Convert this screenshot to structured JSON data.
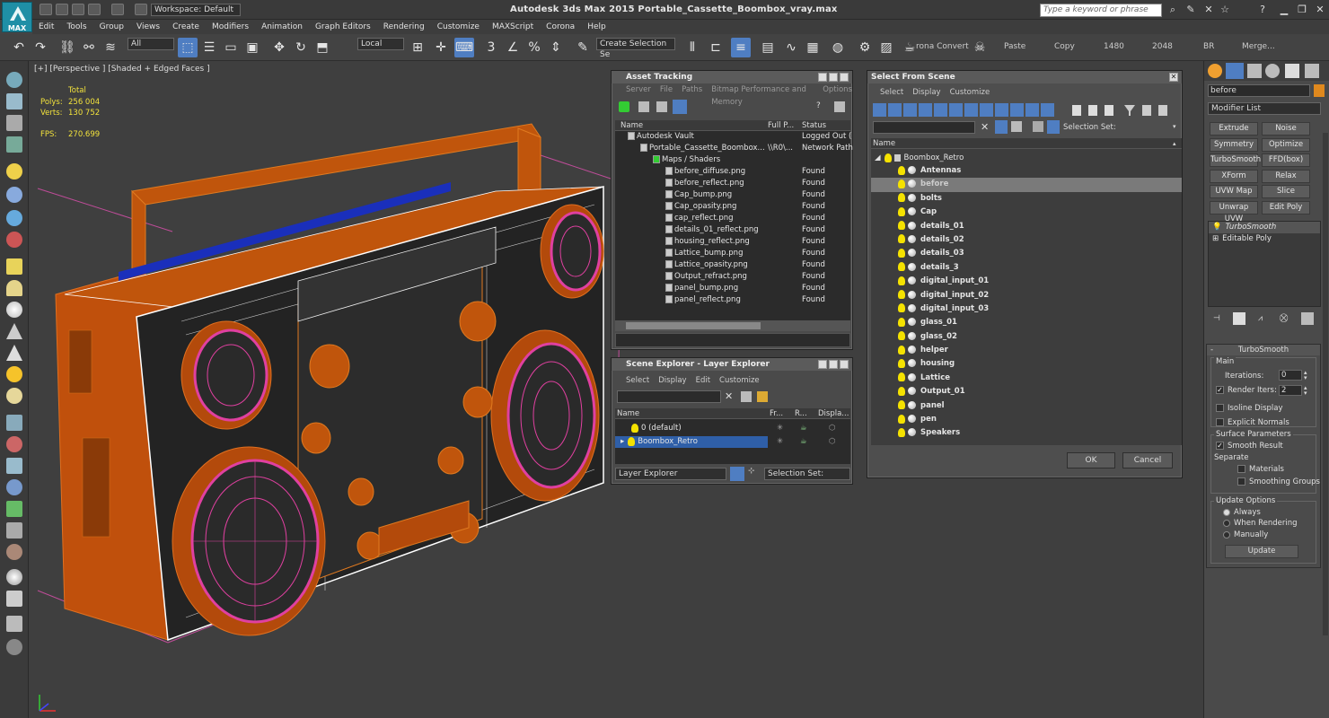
{
  "titlebar": {
    "logo_text": "MAX",
    "workspace": "Workspace: Default",
    "title": "Autodesk 3ds Max  2015     Portable_Cassette_Boombox_vray.max",
    "search_placeholder": "Type a keyword or phrase"
  },
  "menu": [
    "Edit",
    "Tools",
    "Group",
    "Views",
    "Create",
    "Modifiers",
    "Animation",
    "Graph Editors",
    "Rendering",
    "Customize",
    "MAXScript",
    "Corona",
    "Help"
  ],
  "toolbar": {
    "filter": "All",
    "coord": "Local",
    "selection_set": "Create Selection Se",
    "labels": [
      "rona Convert",
      "Paste",
      "Copy",
      "1480",
      "2048",
      "BR",
      "Merge..."
    ]
  },
  "viewport": {
    "label": "[+] [Perspective ] [Shaded + Edged Faces ]",
    "stats": {
      "total": "Total",
      "polys_label": "Polys:",
      "polys": "256 004",
      "verts_label": "Verts:",
      "verts": "130 752",
      "fps_label": "FPS:",
      "fps": "270.699"
    }
  },
  "asset_tracking": {
    "title": "Asset Tracking",
    "menu": [
      "Server",
      "File",
      "Paths",
      "Bitmap Performance and Memory",
      "Options"
    ],
    "columns": [
      "Name",
      "Full P...",
      "Status"
    ],
    "rows": [
      {
        "name": "Autodesk Vault",
        "path": "",
        "status": "Logged Out (",
        "indent": 0
      },
      {
        "name": "Portable_Cassette_Boombox...",
        "path": "\\\\R0\\...",
        "status": "Network Path",
        "indent": 1
      },
      {
        "name": "Maps / Shaders",
        "path": "",
        "status": "",
        "indent": 2
      },
      {
        "name": "before_diffuse.png",
        "path": "",
        "status": "Found",
        "indent": 3
      },
      {
        "name": "before_reflect.png",
        "path": "",
        "status": "Found",
        "indent": 3
      },
      {
        "name": "Cap_bump.png",
        "path": "",
        "status": "Found",
        "indent": 3
      },
      {
        "name": "Cap_opasity.png",
        "path": "",
        "status": "Found",
        "indent": 3
      },
      {
        "name": "cap_reflect.png",
        "path": "",
        "status": "Found",
        "indent": 3
      },
      {
        "name": "details_01_reflect.png",
        "path": "",
        "status": "Found",
        "indent": 3
      },
      {
        "name": "housing_reflect.png",
        "path": "",
        "status": "Found",
        "indent": 3
      },
      {
        "name": "Lattice_bump.png",
        "path": "",
        "status": "Found",
        "indent": 3
      },
      {
        "name": "Lattice_opasity.png",
        "path": "",
        "status": "Found",
        "indent": 3
      },
      {
        "name": "Output_refract.png",
        "path": "",
        "status": "Found",
        "indent": 3
      },
      {
        "name": "panel_bump.png",
        "path": "",
        "status": "Found",
        "indent": 3
      },
      {
        "name": "panel_reflect.png",
        "path": "",
        "status": "Found",
        "indent": 3
      }
    ]
  },
  "layer_explorer": {
    "title": "Scene Explorer - Layer Explorer",
    "menu": [
      "Select",
      "Display",
      "Edit",
      "Customize"
    ],
    "columns": [
      "Name",
      "Fr...",
      "R...",
      "Displa..."
    ],
    "rows": [
      "0 (default)",
      "Boombox_Retro"
    ],
    "footer_dropdown": "Layer Explorer",
    "selection_set": "Selection Set:"
  },
  "select_from_scene": {
    "title": "Select From Scene",
    "menu": [
      "Select",
      "Display",
      "Customize"
    ],
    "selection_set": "Selection Set:",
    "column": "Name",
    "root": "Boombox_Retro",
    "items": [
      "Antennas",
      "before",
      "bolts",
      "Cap",
      "details_01",
      "details_02",
      "details_03",
      "details_3",
      "digital_input_01",
      "digital_input_02",
      "digital_input_03",
      "glass_01",
      "glass_02",
      "helper",
      "housing",
      "Lattice",
      "Output_01",
      "panel",
      "pen",
      "Speakers"
    ],
    "selected_item": "before",
    "ok": "OK",
    "cancel": "Cancel"
  },
  "command_panel": {
    "object_name": "before",
    "modifier_list": "Modifier List",
    "buttons": [
      "Extrude",
      "Noise",
      "Symmetry",
      "Optimize",
      "TurboSmooth",
      "FFD(box)",
      "XForm",
      "Relax",
      "UVW Map",
      "Slice",
      "Unwrap UVW",
      "Edit Poly"
    ],
    "stack": [
      "TurboSmooth",
      "Editable Poly"
    ],
    "rollout_title": "TurboSmooth",
    "main_label": "Main",
    "iterations_label": "Iterations:",
    "iterations": "0",
    "render_iters_label": "Render Iters:",
    "render_iters": "2",
    "isoline": "Isoline Display",
    "explicit_normals": "Explicit Normals",
    "surface_params": "Surface Parameters",
    "smooth_result": "Smooth Result",
    "separate": "Separate",
    "materials": "Materials",
    "smoothing_groups": "Smoothing Groups",
    "update_options": "Update Options",
    "always": "Always",
    "when_rendering": "When Rendering",
    "manually": "Manually",
    "update": "Update"
  },
  "colors": {
    "accent": "#4f7ec2",
    "orange": "#c8500a",
    "wire_pink": "#e040a0",
    "selected_row": "#2f5fa8"
  }
}
